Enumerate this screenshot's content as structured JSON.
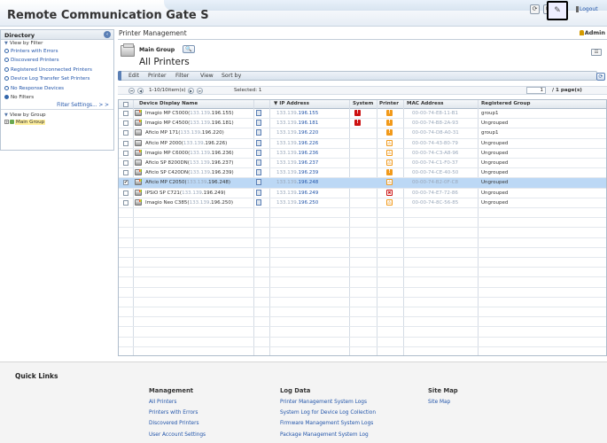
{
  "app": {
    "title": "Remote Communication Gate S",
    "logout_label": "Logout",
    "accent_color": "#5a7fb5"
  },
  "header_icons": [
    "refresh-icon",
    "power-icon",
    "help-icon",
    "tools-icon"
  ],
  "sidebar": {
    "title": "Directory",
    "filter_section": "View by Filter",
    "filters": [
      {
        "label": "Printers with Errors",
        "selected": false
      },
      {
        "label": "Discovered Printers",
        "selected": false
      },
      {
        "label": "Registered Unconnected Printers",
        "selected": false
      },
      {
        "label": "Device Log Transfer Set Printers",
        "selected": false
      },
      {
        "label": "No Response Devices",
        "selected": false
      },
      {
        "label": "No Filters",
        "selected": true
      }
    ],
    "filter_settings_label": "Filter Settings... > >",
    "group_section": "View by Group",
    "group_root": "Main Group"
  },
  "main": {
    "title": "Printer Management",
    "user": "Admin",
    "group_name": "Main Group",
    "view_title": "All Printers",
    "menu": [
      "Edit",
      "Printer",
      "Filter",
      "View",
      "Sort by"
    ],
    "pager": {
      "range_text": "1-10/10item(s)",
      "selected_text": "Selected:  1",
      "page_value": "1",
      "page_total": "/ 1 page(s)"
    },
    "columns": [
      "Device Display Name",
      "IP Address",
      "System",
      "Printer",
      "MAC Address",
      "Registered Group"
    ],
    "rows": [
      {
        "name": "Imagio MP C5000(",
        "ip_mask": "133.139",
        "ip_tail": ".196.155)",
        "ip_cell_mask": "133.139",
        "ip_cell_tail": ".196.155",
        "system": "red",
        "printer": "orange",
        "mac": "00-00-74-E8-11-B1",
        "group": "group1",
        "color": true,
        "selected": false
      },
      {
        "name": "Imagio MP C4500(",
        "ip_mask": "133.139",
        "ip_tail": ".196.181)",
        "ip_cell_mask": "133.139",
        "ip_cell_tail": ".196.181",
        "system": "red",
        "printer": "orange",
        "mac": "00-00-74-B8-2A-93",
        "group": "Ungrouped",
        "color": true,
        "selected": false
      },
      {
        "name": "Aficio MP 171(",
        "ip_mask": "133.139",
        "ip_tail": ".196.220)",
        "ip_cell_mask": "133.139",
        "ip_cell_tail": ".196.220",
        "system": "",
        "printer": "orange",
        "mac": "00-00-74-D8-A0-31",
        "group": "group1",
        "color": false,
        "selected": false
      },
      {
        "name": "Aficio MP 2000(",
        "ip_mask": "133.139",
        "ip_tail": ".196.226)",
        "ip_cell_mask": "133.139",
        "ip_cell_tail": ".196.226",
        "system": "",
        "printer": "orange-o",
        "mac": "00-00-74-43-80-79",
        "group": "Ungrouped",
        "color": false,
        "selected": false
      },
      {
        "name": "Imagio MP C6000(",
        "ip_mask": "133.139",
        "ip_tail": ".196.236)",
        "ip_cell_mask": "133.139",
        "ip_cell_tail": ".196.236",
        "system": "",
        "printer": "orange-o",
        "mac": "00-00-74-C3-A8-96",
        "group": "Ungrouped",
        "color": true,
        "selected": false
      },
      {
        "name": "Aficio SP 8200DN(",
        "ip_mask": "133.139",
        "ip_tail": ".196.237)",
        "ip_cell_mask": "133.139",
        "ip_cell_tail": ".196.237",
        "system": "",
        "printer": "orange-o",
        "mac": "00-00-74-C1-F0-37",
        "group": "Ungrouped",
        "color": false,
        "selected": false
      },
      {
        "name": "Aficio SP C420DN(",
        "ip_mask": "133.139",
        "ip_tail": ".196.239)",
        "ip_cell_mask": "133.139",
        "ip_cell_tail": ".196.239",
        "system": "",
        "printer": "orange",
        "mac": "00-00-74-CE-40-50",
        "group": "Ungrouped",
        "color": true,
        "selected": false
      },
      {
        "name": "Aficio MP C2050(",
        "ip_mask": "133.139",
        "ip_tail": ".196.248)",
        "ip_cell_mask": "133.139",
        "ip_cell_tail": ".196.248",
        "system": "",
        "printer": "orange-o",
        "mac": "00-00-74-B2-0F-C8",
        "group": "Ungrouped",
        "color": true,
        "selected": true
      },
      {
        "name": "IPSiO SP C721(",
        "ip_mask": "133.139",
        "ip_tail": ".196.249)",
        "ip_cell_mask": "133.139",
        "ip_cell_tail": ".196.249",
        "system": "",
        "printer": "red-o",
        "mac": "00-00-74-E7-72-86",
        "group": "Ungrouped",
        "color": true,
        "selected": false
      },
      {
        "name": "Imagio Neo C385(",
        "ip_mask": "133.139",
        "ip_tail": ".196.250)",
        "ip_cell_mask": "133.139",
        "ip_cell_tail": ".196.250",
        "system": "",
        "printer": "orange-o",
        "mac": "00-00-74-8C-56-85",
        "group": "Ungrouped",
        "color": true,
        "selected": false
      }
    ]
  },
  "quick_links": {
    "title": "Quick Links",
    "columns": [
      {
        "heading": "Management",
        "links": [
          "All Printers",
          "Printers with Errors",
          "Discovered Printers",
          "User Account Settings"
        ]
      },
      {
        "heading": "Log Data",
        "links": [
          "Printer Management System Logs",
          "System Log for Device Log Collection",
          "Firmware Management System Logs",
          "Package Management System Log"
        ]
      },
      {
        "heading": "Site Map",
        "links": [
          "Site Map"
        ]
      }
    ]
  }
}
